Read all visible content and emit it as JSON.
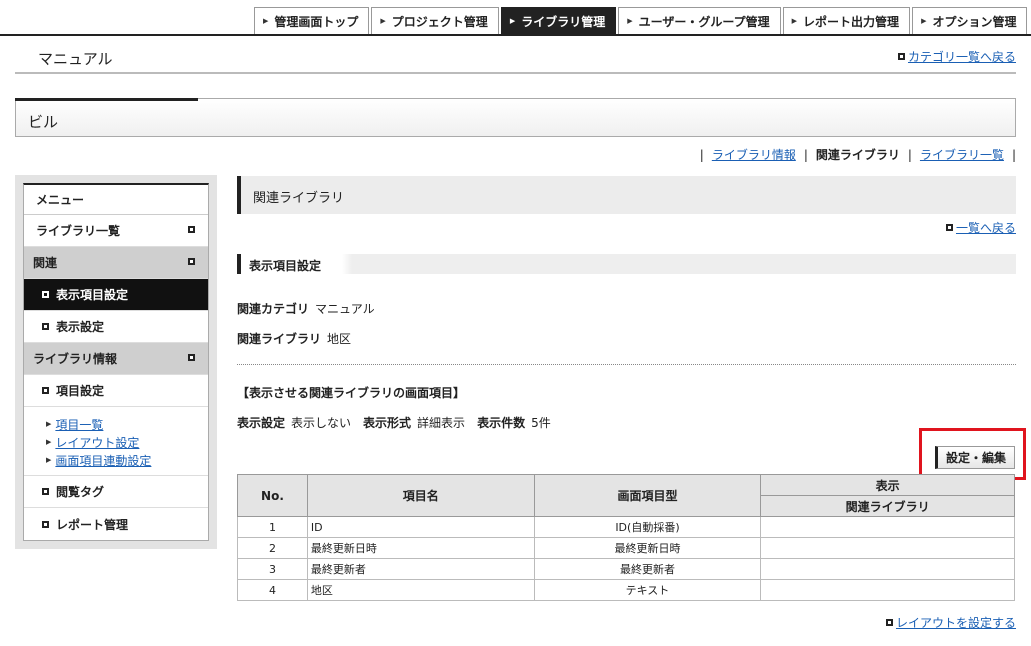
{
  "nav": {
    "tabs": [
      {
        "label": "管理画面トップ",
        "active": false
      },
      {
        "label": "プロジェクト管理",
        "active": false
      },
      {
        "label": "ライブラリ管理",
        "active": true
      },
      {
        "label": "ユーザー・グループ管理",
        "active": false
      },
      {
        "label": "レポート出力管理",
        "active": false
      },
      {
        "label": "オプション管理",
        "active": false
      }
    ]
  },
  "page": {
    "title": "マニュアル",
    "back_to_category": "カテゴリ一覧へ戻る",
    "record_name": "ビル"
  },
  "subnav": {
    "library_info": "ライブラリ情報",
    "related_library": "関連ライブラリ",
    "library_list": "ライブラリ一覧"
  },
  "sidebar": {
    "menu_label": "メニュー",
    "library_list": "ライブラリ一覧",
    "related": "関連",
    "display_item_setting": "表示項目設定",
    "display_setting": "表示設定",
    "library_info": "ライブラリ情報",
    "item_setting": "項目設定",
    "item_list": "項目一覧",
    "layout_setting": "レイアウト設定",
    "screen_item_link_setting": "画面項目連動設定",
    "browse_tag": "閲覧タグ",
    "report_management": "レポート管理"
  },
  "main": {
    "panel_title": "関連ライブラリ",
    "back_to_list": "一覧へ戻る",
    "section_title": "表示項目設定",
    "related_category_label": "関連カテゴリ",
    "related_category_value": "マニュアル",
    "related_library_label": "関連ライブラリ",
    "related_library_value": "地区",
    "bracket_title": "【表示させる関連ライブラリの画面項目】",
    "display_setting_label": "表示設定",
    "display_setting_value": "表示しない",
    "display_format_label": "表示形式",
    "display_format_value": "詳細表示",
    "display_count_label": "表示件数",
    "display_count_value": "5件",
    "edit_button": "設定・編集",
    "set_layout_link": "レイアウトを設定する"
  },
  "table": {
    "headers": {
      "no": "No.",
      "item_name": "項目名",
      "screen_item_type": "画面項目型",
      "display": "表示",
      "related_library": "関連ライブラリ"
    },
    "rows": [
      {
        "no": "1",
        "name": "ID",
        "type": "ID(自動採番)",
        "display": ""
      },
      {
        "no": "2",
        "name": "最終更新日時",
        "type": "最終更新日時",
        "display": ""
      },
      {
        "no": "3",
        "name": "最終更新者",
        "type": "最終更新者",
        "display": ""
      },
      {
        "no": "4",
        "name": "地区",
        "type": "テキスト",
        "display": ""
      }
    ]
  }
}
